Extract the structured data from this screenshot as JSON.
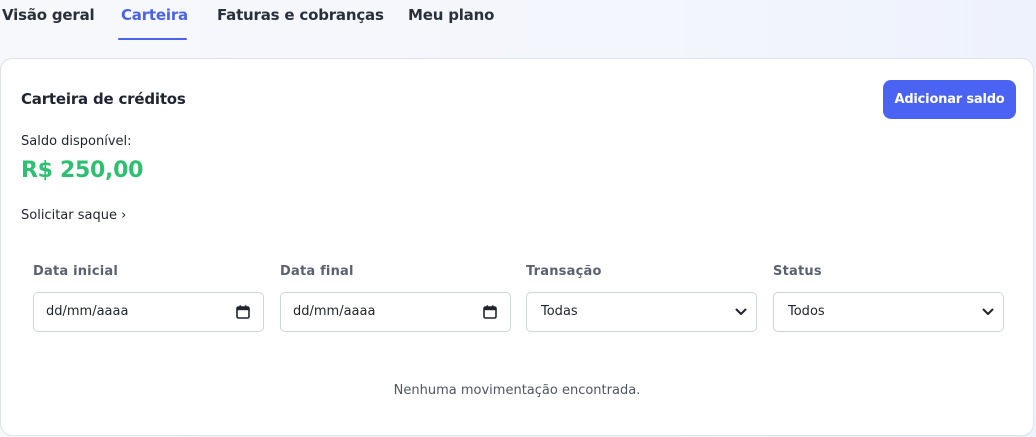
{
  "tabs": [
    {
      "label": "Visão geral",
      "active": false
    },
    {
      "label": "Carteira",
      "active": true
    },
    {
      "label": "Faturas e cobranças",
      "active": false
    },
    {
      "label": "Meu plano",
      "active": false
    }
  ],
  "colors": {
    "accent": "#4a63e8",
    "button": "#4a63f2",
    "balance": "#2fbf71"
  },
  "wallet": {
    "title": "Carteira de créditos",
    "add_button_label": "Adicionar saldo",
    "balance_label": "Saldo disponível:",
    "balance_value": "R$ 250,00",
    "withdraw_link": "Solicitar saque ›"
  },
  "filters": {
    "start_date": {
      "label": "Data inicial",
      "value": "dd/mm/aaaa",
      "icon": "calendar-icon"
    },
    "end_date": {
      "label": "Data final",
      "value": "dd/mm/aaaa",
      "icon": "calendar-icon"
    },
    "transaction": {
      "label": "Transação",
      "selected": "Todas",
      "icon": "chevron-down-icon"
    },
    "status": {
      "label": "Status",
      "selected": "Todos",
      "icon": "chevron-down-icon"
    }
  },
  "empty_message": "Nenhuma movimentação encontrada."
}
